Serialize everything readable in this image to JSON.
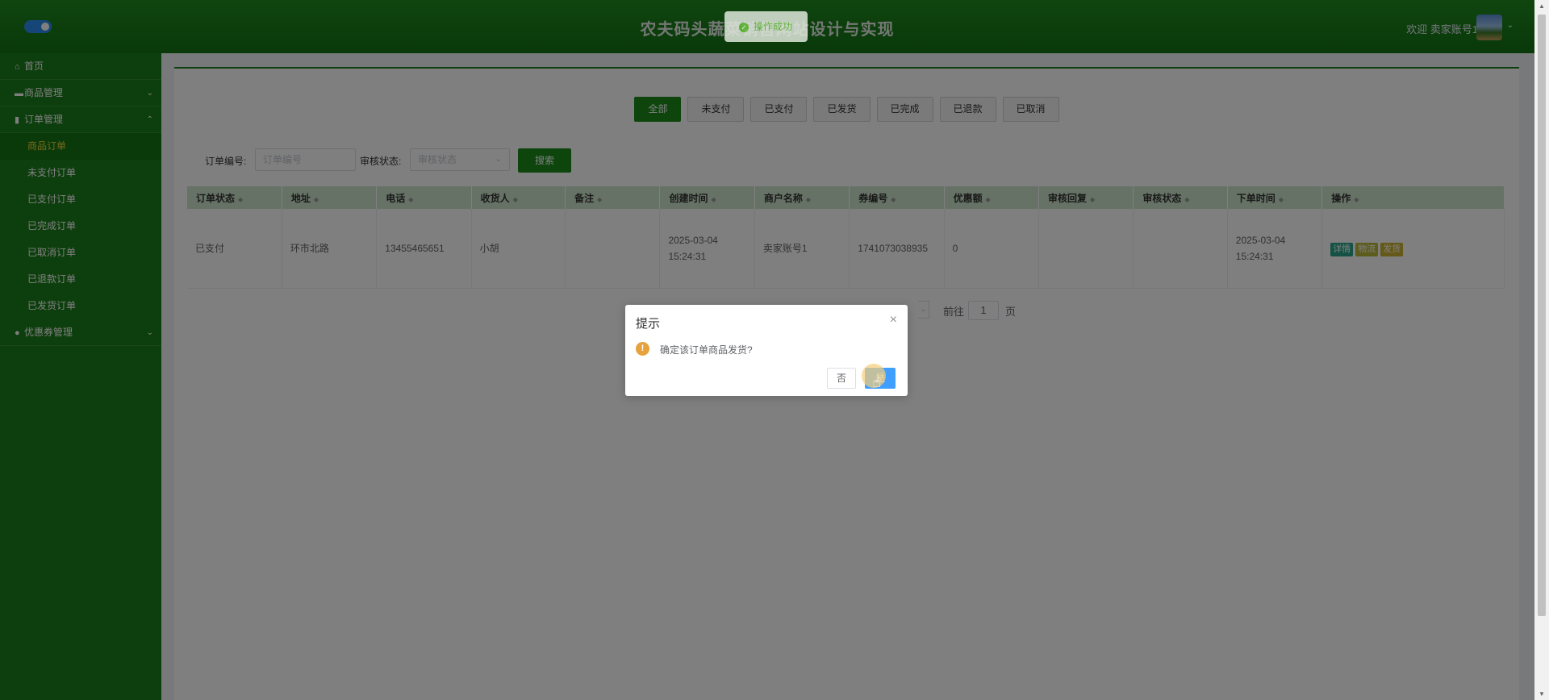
{
  "header": {
    "title": "农夫码头蔬菜销售网站设计与实现",
    "welcome": "欢迎 卖家账号1",
    "caret": "⌄"
  },
  "sidebar": {
    "home": {
      "icon": "⌂",
      "label": "首页"
    },
    "goods": {
      "icon": "▬",
      "label": "商品管理",
      "arrow": "⌄"
    },
    "orders": {
      "icon": "▮",
      "label": "订单管理",
      "arrow": "⌃",
      "children": [
        "商品订单",
        "未支付订单",
        "已支付订单",
        "已完成订单",
        "已取消订单",
        "已退款订单",
        "已发货订单"
      ]
    },
    "coupons": {
      "icon": "●",
      "label": "优惠券管理",
      "arrow": "⌄"
    }
  },
  "status_tabs": [
    "全部",
    "未支付",
    "已支付",
    "已发货",
    "已完成",
    "已退款",
    "已取消"
  ],
  "search": {
    "order_no_label": "订单编号:",
    "order_no_placeholder": "订单编号",
    "audit_label": "审核状态:",
    "audit_placeholder": "审核状态",
    "button": "搜索"
  },
  "table": {
    "headers": [
      "订单状态",
      "地址",
      "电话",
      "收货人",
      "备注",
      "创建时间",
      "商户名称",
      "券编号",
      "优惠额",
      "审核回复",
      "审核状态",
      "下单时间",
      "操作"
    ],
    "row": {
      "status": "已支付",
      "address": "环市北路",
      "phone": "13455465651",
      "receiver": "小胡",
      "remark": "",
      "created": "2025-03-04 15:24:31",
      "merchant": "卖家账号1",
      "coupon_no": "1741073038935",
      "discount": "0",
      "audit_reply": "",
      "audit_status": "",
      "order_time": "2025-03-04 15:24:31",
      "ops": [
        "详情",
        "物流",
        "发货"
      ]
    }
  },
  "pager": {
    "goto": "前往",
    "page": "1",
    "unit": "页"
  },
  "toast": {
    "text": "操作成功",
    "icon": "✓"
  },
  "dialog": {
    "title": "提示",
    "close": "×",
    "warn_icon": "!",
    "message": "确定该订单商品发货?",
    "no": "否",
    "yes": "是"
  },
  "colors": {
    "header": "#1a7d1a",
    "sidebar": "#1a7d1a",
    "primary_button": "#1a8a1a",
    "dialog_yes": "#409eff",
    "active_menu": "#f0d43a"
  }
}
